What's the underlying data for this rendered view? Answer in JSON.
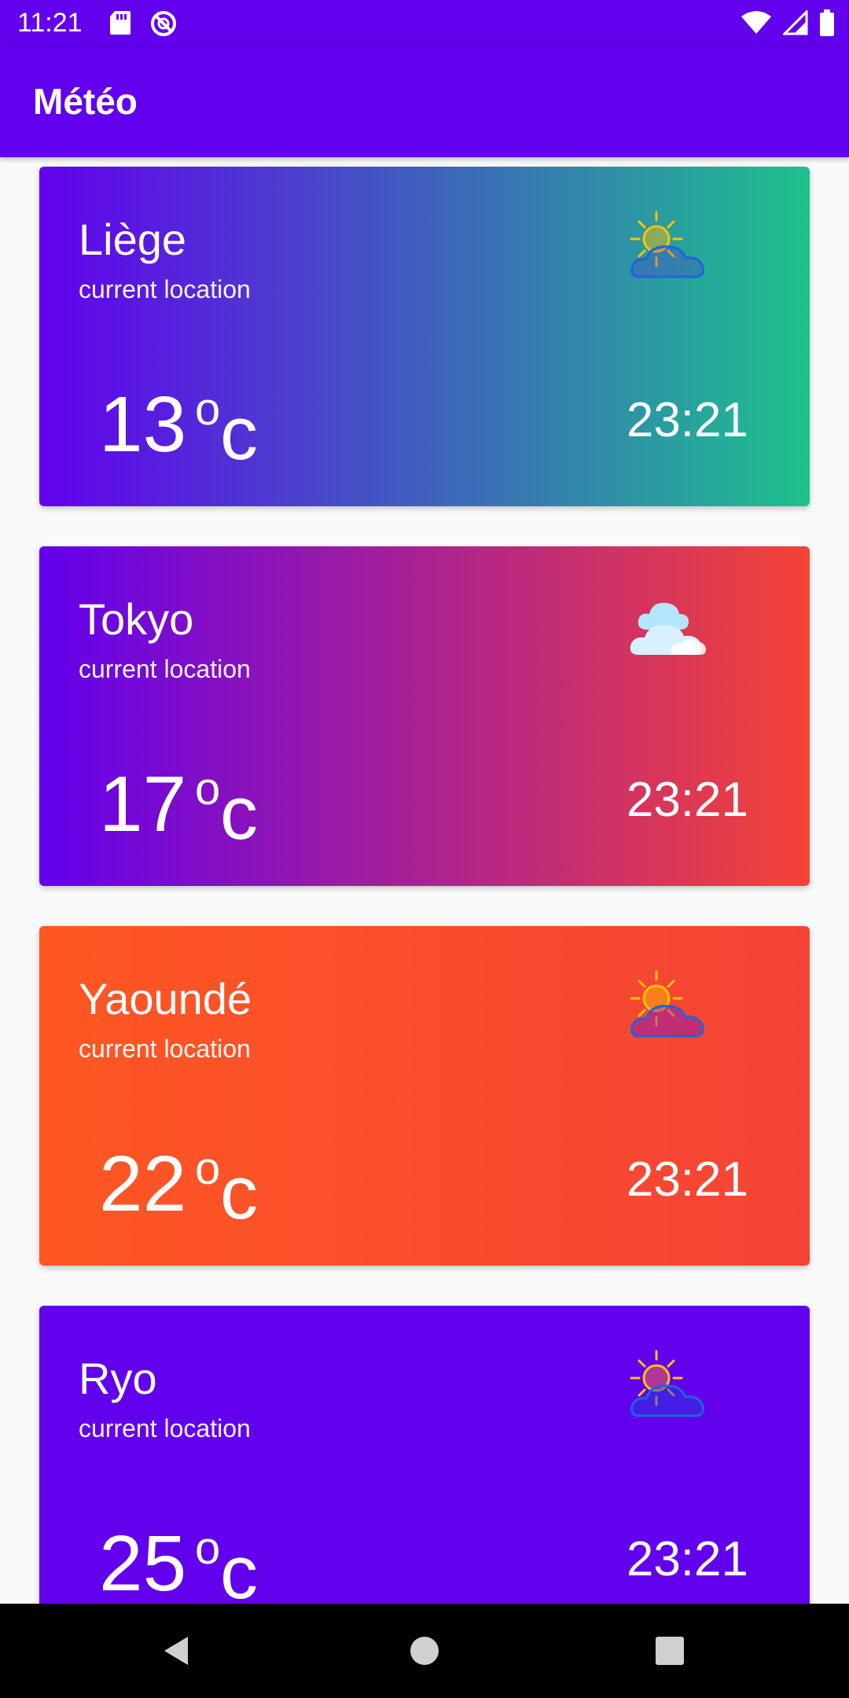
{
  "status_bar": {
    "time": "11:21",
    "icons": [
      "sd-card-icon",
      "no-data-saver-icon",
      "wifi-icon",
      "signal-icon",
      "battery-icon"
    ]
  },
  "app_bar": {
    "title": "Météo"
  },
  "cards": [
    {
      "city": "Liège",
      "subtitle": "current location",
      "temp": "13",
      "degree": "o",
      "unit": "c",
      "time": "23:21",
      "icon": "partly-cloudy-day-icon",
      "gradient": [
        "#6200EE",
        "#1DC18D"
      ]
    },
    {
      "city": "Tokyo",
      "subtitle": "current location",
      "temp": "17",
      "degree": "o",
      "unit": "c",
      "time": "23:21",
      "icon": "cloudy-icon",
      "gradient": [
        "#6200EE",
        "#F44336"
      ]
    },
    {
      "city": "Yaoundé",
      "subtitle": "current location",
      "temp": "22",
      "degree": "o",
      "unit": "c",
      "time": "23:21",
      "icon": "partly-cloudy-day-icon",
      "gradient": [
        "#FF5722",
        "#F44336"
      ]
    },
    {
      "city": "Ryo",
      "subtitle": "current location",
      "temp": "25",
      "degree": "o",
      "unit": "c",
      "time": "23:21",
      "icon": "partly-cloudy-day-icon",
      "gradient": [
        "#6200EE",
        "#6200EE"
      ]
    }
  ],
  "nav_bar": {
    "icons": [
      "back-icon",
      "home-icon",
      "recents-icon"
    ]
  },
  "colors": {
    "primary": "#6200EE",
    "background": "#FAFAFA"
  }
}
